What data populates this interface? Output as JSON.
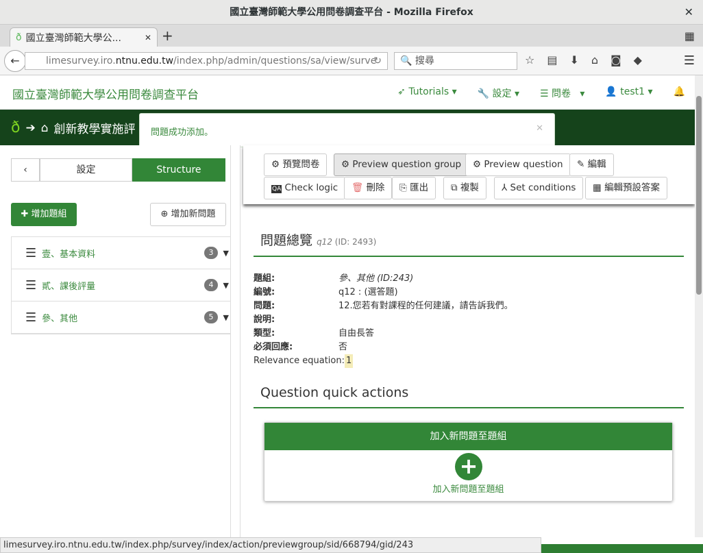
{
  "window": {
    "title": "國立臺灣師範大學公用問卷調查平台 - Mozilla Firefox"
  },
  "browser": {
    "tab_title": "國立臺灣師範大學公...",
    "url_prefix": "limesurvey.iro.",
    "url_domain": "ntnu.edu.tw",
    "url_path": "/index.php/admin/questions/sa/view/surve",
    "search_placeholder": "搜尋"
  },
  "header": {
    "brand": "國立臺灣師範大學公用問卷調查平台",
    "menu": [
      "Tutorials",
      "設定",
      "問卷",
      "test1"
    ]
  },
  "breadcrumb": {
    "survey": "創新教學實施評"
  },
  "alert": {
    "message": "問題成功添加。"
  },
  "sidebar": {
    "tabs": [
      "設定",
      "Structure"
    ],
    "add_group": "增加題組",
    "add_question": "增加新問題",
    "groups": [
      {
        "label": "壹、基本資料",
        "count": "3"
      },
      {
        "label": "貳、課後評量",
        "count": "4"
      },
      {
        "label": "參、其他",
        "count": "5"
      }
    ]
  },
  "toolbar": {
    "preview_survey": "預覽問卷",
    "preview_group": "Preview question group",
    "preview_question": "Preview question",
    "edit": "編輯",
    "check_logic": "Check logic",
    "delete": "刪除",
    "export": "匯出",
    "copy": "複製",
    "set_conditions": "Set conditions",
    "edit_defaults": "編輯預設答案"
  },
  "overview": {
    "title": "問題總覽",
    "code": "q12",
    "id": "(ID: 2493)",
    "rows": [
      {
        "k": "題組:",
        "v": "參、其他 (ID:243)"
      },
      {
        "k": "編號:",
        "v": "q12 : (選答題)"
      },
      {
        "k": "問題:",
        "v": "12.您若有對課程的任何建議，請告訴我們。"
      },
      {
        "k": "說明:",
        "v": ""
      },
      {
        "k": "類型:",
        "v": "自由長答"
      },
      {
        "k": "必須回應:",
        "v": "否"
      }
    ],
    "relevance_label": "Relevance equation:",
    "relevance_value": "1"
  },
  "quick_actions": {
    "title": "Question quick actions",
    "panel_title": "加入新問題至題組",
    "panel_link": "加入新問題至題組"
  },
  "statusbar": {
    "url": "limesurvey.iro.ntnu.edu.tw/index.php/survey/index/action/previewgroup/sid/668794/gid/243"
  }
}
